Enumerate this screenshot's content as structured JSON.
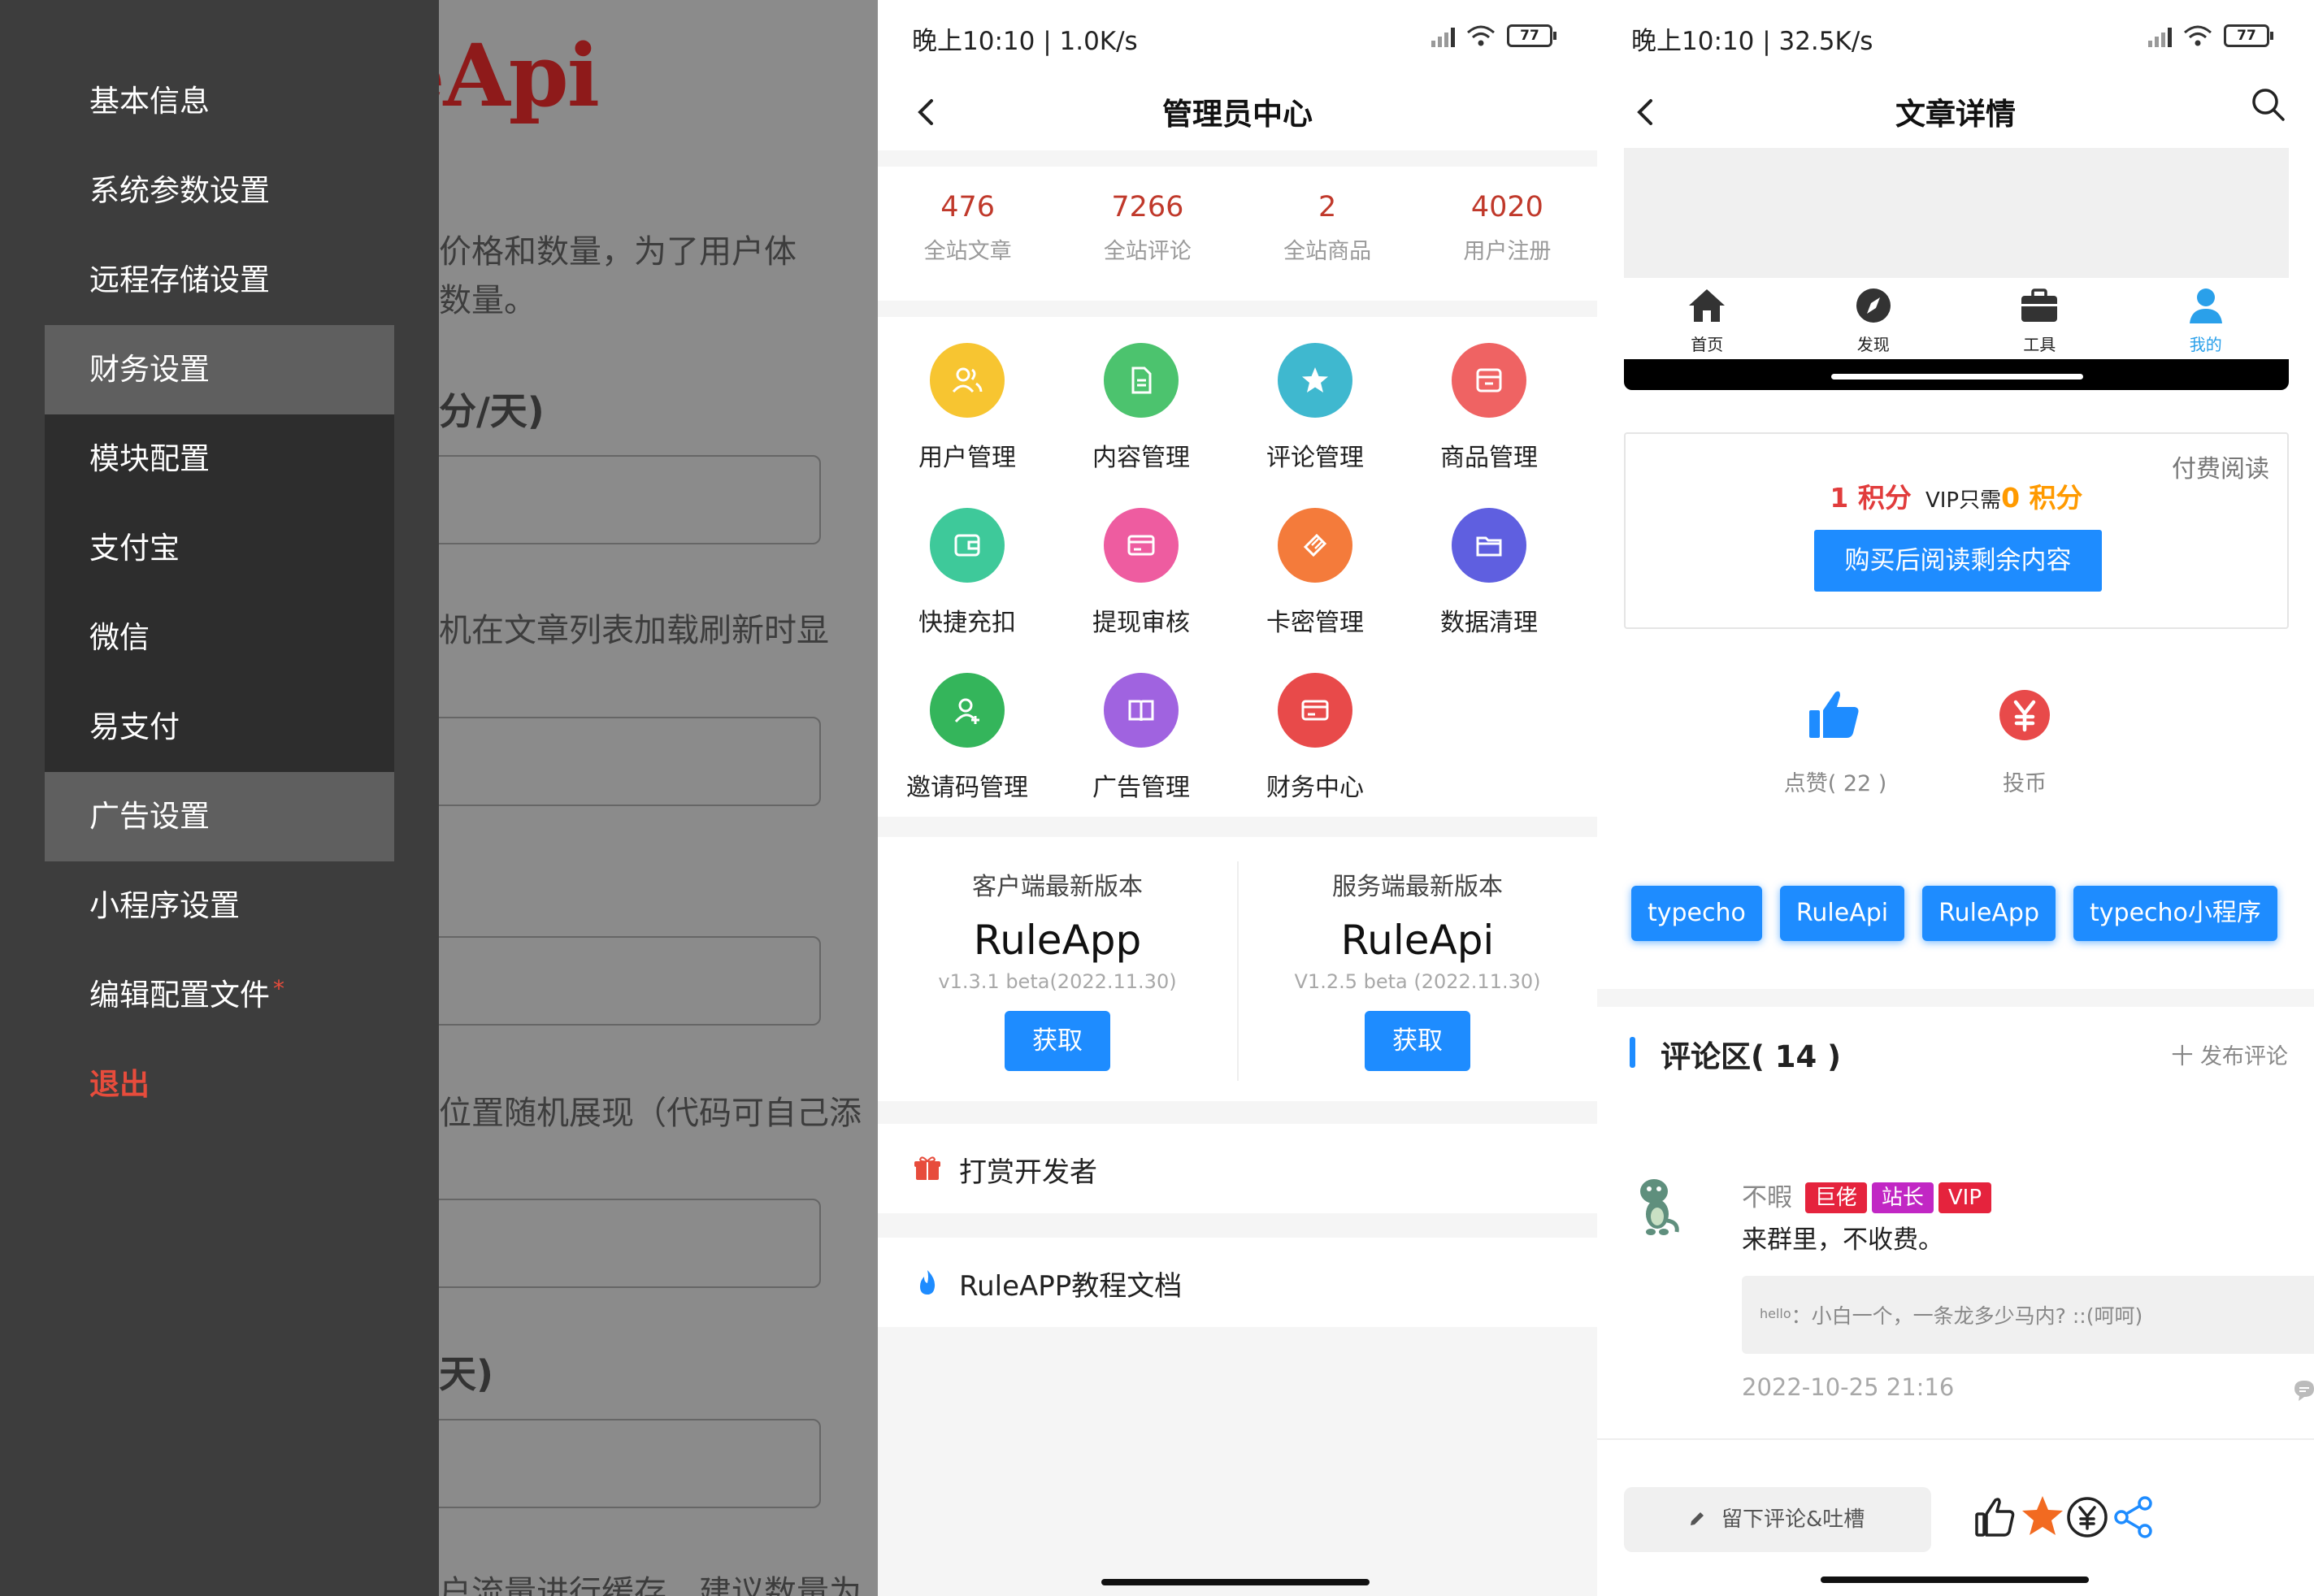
{
  "panel1": {
    "background": {
      "title": "eApi",
      "desc_line1": "价格和数量，为了用户体",
      "desc_line2": "数量。",
      "heading1": "分/天)",
      "desc2": "机在文章列表加载刷新时显",
      "desc3": "位置随机展现（代码可自己添",
      "heading2": "天)",
      "desc4": "户流量进行缓存，建议数量为"
    },
    "menu": [
      {
        "label": "基本信息"
      },
      {
        "label": "系统参数设置"
      },
      {
        "label": "远程存储设置"
      },
      {
        "label": "财务设置"
      },
      {
        "label": "模块配置"
      },
      {
        "label": "支付宝"
      },
      {
        "label": "微信"
      },
      {
        "label": "易支付"
      },
      {
        "label": "广告设置"
      },
      {
        "label": "小程序设置"
      },
      {
        "label": "编辑配置文件",
        "required_mark": "*"
      },
      {
        "label": "退出"
      }
    ],
    "active_items": [
      "财务设置",
      "广告设置"
    ]
  },
  "panel2": {
    "status": {
      "time_speed": "晚上10:10 | 1.0K/s",
      "battery": "77"
    },
    "nav": {
      "title": "管理员中心"
    },
    "stats": [
      {
        "value": "476",
        "label": "全站文章"
      },
      {
        "value": "7266",
        "label": "全站评论"
      },
      {
        "value": "2",
        "label": "全站商品"
      },
      {
        "value": "4020",
        "label": "用户注册"
      }
    ],
    "grid": [
      {
        "label": "用户管理",
        "icon": "users-icon",
        "color": "#f7c531"
      },
      {
        "label": "内容管理",
        "icon": "document-icon",
        "color": "#4cc36e"
      },
      {
        "label": "评论管理",
        "icon": "star-icon",
        "color": "#3fb8cf"
      },
      {
        "label": "商品管理",
        "icon": "store-icon",
        "color": "#ef6363"
      },
      {
        "label": "快捷充扣",
        "icon": "wallet-icon",
        "color": "#3ec99a"
      },
      {
        "label": "提现审核",
        "icon": "card-icon",
        "color": "#ee5ca0"
      },
      {
        "label": "卡密管理",
        "icon": "ticket-icon",
        "color": "#f47b3b"
      },
      {
        "label": "数据清理",
        "icon": "folder-icon",
        "color": "#5f5fe0"
      },
      {
        "label": "邀请码管理",
        "icon": "user-add-icon",
        "color": "#34b55b"
      },
      {
        "label": "广告管理",
        "icon": "book-icon",
        "color": "#a063e0"
      },
      {
        "label": "财务中心",
        "icon": "card-icon",
        "color": "#e84a4a"
      }
    ],
    "versions": [
      {
        "title": "客户端最新版本",
        "name": "RuleApp",
        "version": "v1.3.1 beta(2022.11.30)",
        "button": "获取"
      },
      {
        "title": "服务端最新版本",
        "name": "RuleApi",
        "version": "V1.2.5 beta (2022.11.30)",
        "button": "获取"
      }
    ],
    "links": [
      {
        "label": "打赏开发者",
        "icon": "gift-icon",
        "color": "#e74c3c"
      },
      {
        "label": "RuleAPP教程文档",
        "icon": "flame-icon",
        "color": "#1e8cff"
      }
    ]
  },
  "panel3": {
    "status": {
      "time_speed": "晚上10:10 | 32.5K/s",
      "battery": "77"
    },
    "nav": {
      "title": "文章详情"
    },
    "tabs": [
      {
        "label": "首页",
        "icon": "home-icon"
      },
      {
        "label": "发现",
        "icon": "compass-icon"
      },
      {
        "label": "工具",
        "icon": "briefcase-icon"
      },
      {
        "label": "我的",
        "icon": "user-icon"
      }
    ],
    "pay": {
      "tag": "付费阅读",
      "price": "1 积分",
      "vip_prefix": "VIP只需",
      "vip_price": "0 积分",
      "button": "购买后阅读剩余内容"
    },
    "actions": {
      "like": "点赞( 22 )",
      "coin": "投币"
    },
    "tags": [
      "typecho",
      "RuleApi",
      "RuleApp",
      "typecho小程序"
    ],
    "comments_header": {
      "title": "评论区( 14 )",
      "add": "十 发布评论"
    },
    "comment": {
      "name": "不暇",
      "badges": [
        {
          "label": "巨佬",
          "color": "#e5233d"
        },
        {
          "label": "站长",
          "color": "#c127c4"
        },
        {
          "label": "VIP",
          "color": "#e5233d"
        }
      ],
      "text": "来群里，不收费。",
      "quote_user": "hello",
      "quote_text": "：小白一个，一条龙多少马内? ::(呵呵)",
      "date": "2022-10-25 21:16"
    },
    "bottom": {
      "input_placeholder": "留下评论&吐槽"
    }
  },
  "colors": {
    "accent": "#1e8cff",
    "danger": "#e74c3c",
    "drawer": "#3d3d3d"
  }
}
